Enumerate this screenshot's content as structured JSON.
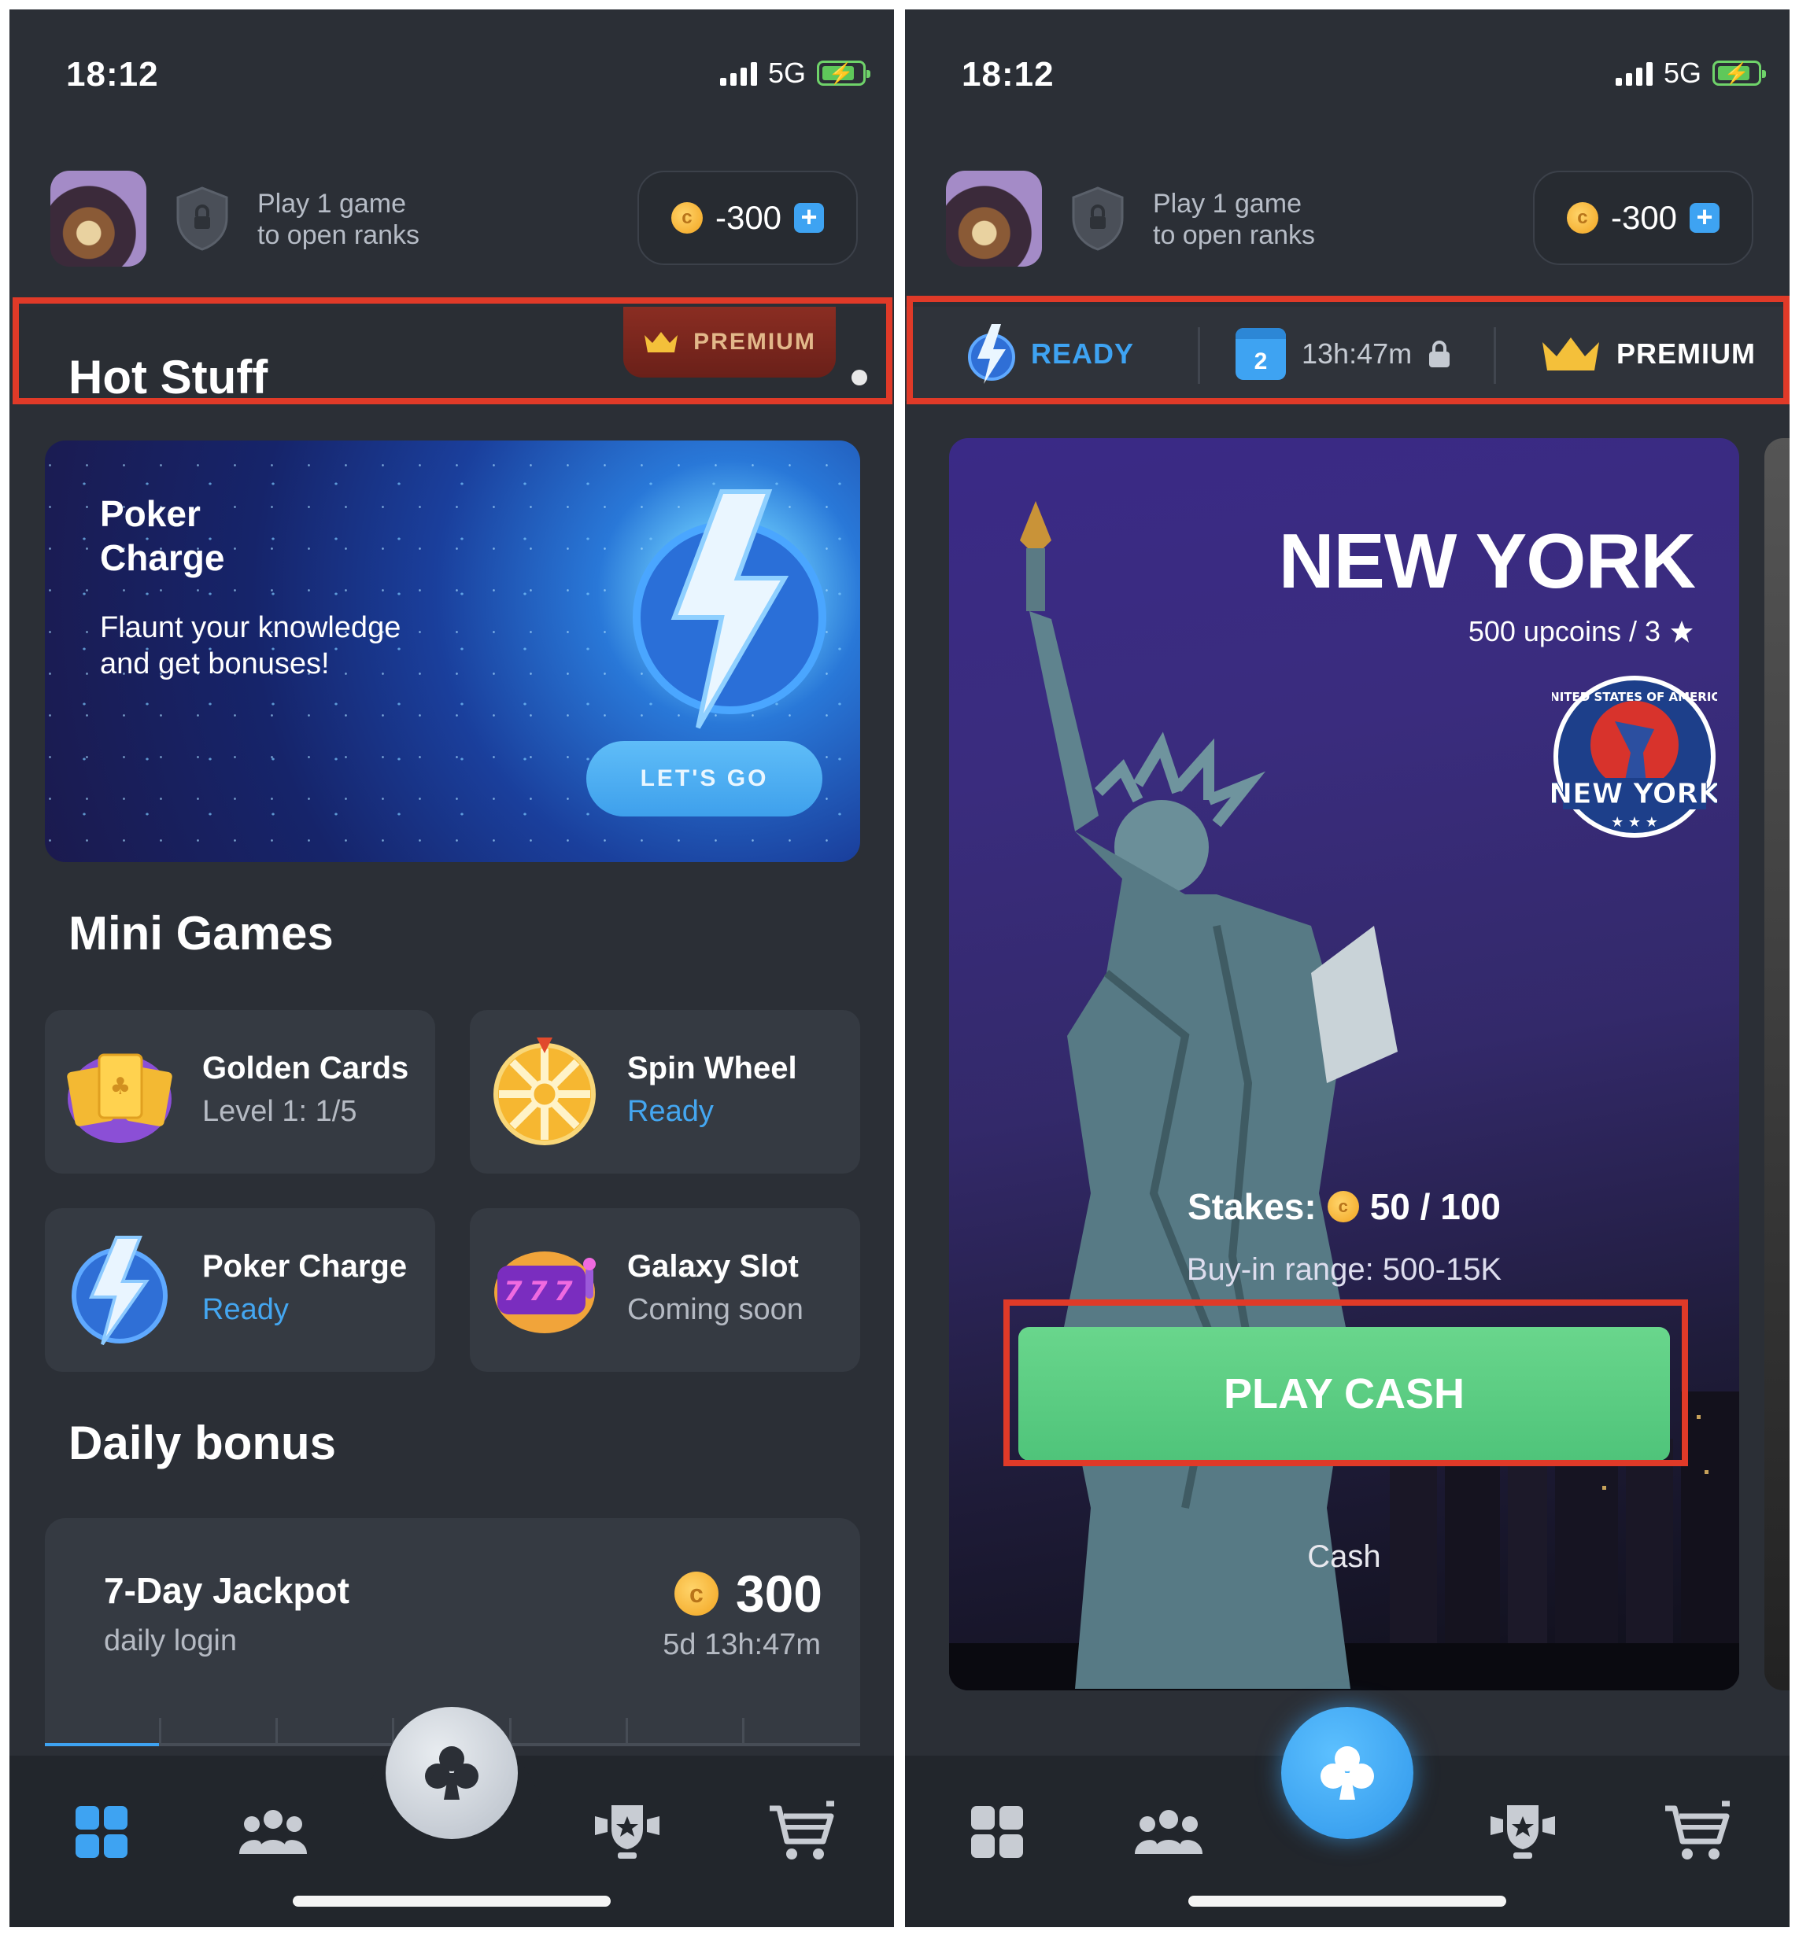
{
  "status_bar": {
    "time": "18:12",
    "network": "5G"
  },
  "header": {
    "rank_line1": "Play 1 game",
    "rank_line2": "to open ranks",
    "balance": "-300",
    "coin_symbol": "c"
  },
  "left": {
    "hot_title": "Hot Stuff",
    "premium_label": "PREMIUM",
    "promo": {
      "title_line1": "Poker",
      "title_line2": "Charge",
      "desc_line1": "Flaunt your knowledge",
      "desc_line2": "and get bonuses!",
      "button": "LET'S GO"
    },
    "mini_games_title": "Mini Games",
    "mini_games": [
      {
        "name": "Golden Cards",
        "status": "Level 1: 1/5",
        "icon": "golden-cards-icon"
      },
      {
        "name": "Spin Wheel",
        "status": "Ready",
        "icon": "spin-wheel-icon"
      },
      {
        "name": "Poker Charge",
        "status": "Ready",
        "icon": "lightning-icon"
      },
      {
        "name": "Galaxy Slot",
        "status": "Coming soon",
        "icon": "slot-machine-icon"
      }
    ],
    "daily_title": "Daily bonus",
    "daily": {
      "title": "7-Day Jackpot",
      "subtitle": "daily login",
      "amount": "300",
      "timer": "5d 13h:47m",
      "progress": 0.143
    }
  },
  "right": {
    "feature_bar": {
      "ready_label": "READY",
      "calendar_day": "2",
      "timer": "13h:47m",
      "premium_label": "PREMIUM"
    },
    "city": {
      "title": "NEW YORK",
      "subtitle": "500 upcoins / 3",
      "seal_text_top": "UNITED STATES OF AMERICA",
      "seal_text_main": "NEW YORK",
      "stakes_label": "Stakes:",
      "stakes_value": "50 / 100",
      "buyin": "Buy-in range: 500-15K",
      "play_button": "PLAY CASH",
      "mode": "Cash"
    }
  },
  "nav": {
    "items": [
      "lobby-grid-icon",
      "friends-icon",
      "club-icon",
      "trophy-icon",
      "cart-icon"
    ],
    "accent": "#3ea3f2"
  },
  "colors": {
    "background": "#2b2f36",
    "accent_blue": "#3ea3f2",
    "play_green": "#5ccd82",
    "highlight_red": "#e03a28",
    "premium_gold": "#f4c03a"
  }
}
